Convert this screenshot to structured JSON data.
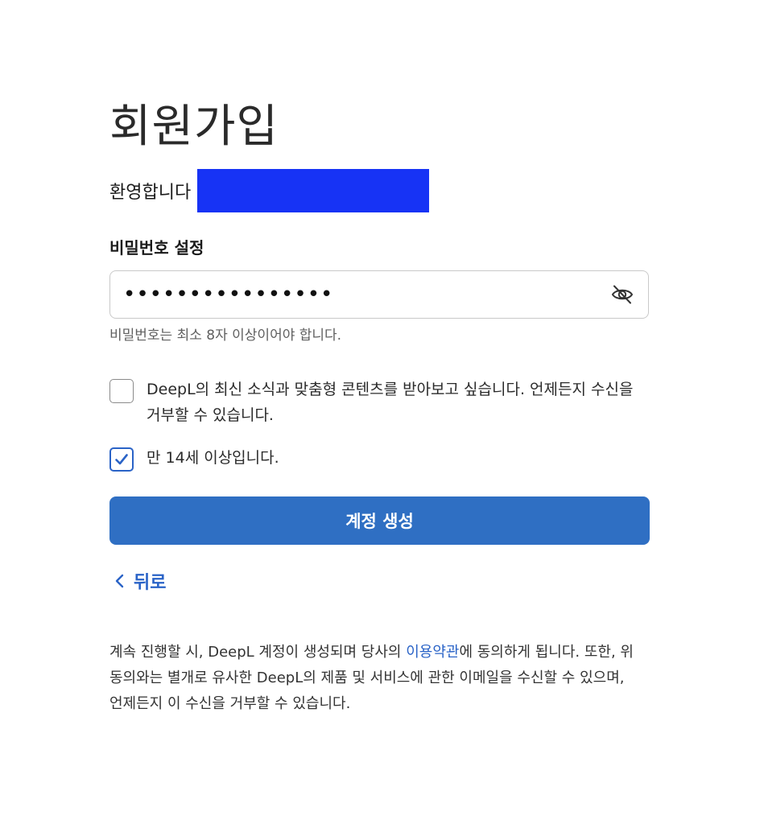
{
  "signup": {
    "title": "회원가입",
    "welcome": "환영합니다",
    "password_label": "비밀번호 설정",
    "password_value": "••••••••••••••••",
    "password_hint": "비밀번호는 최소 8자 이상이어야 합니다.",
    "newsletter": {
      "label": "DeepL의 최신 소식과 맞춤형 콘텐츠를 받아보고 싶습니다. 언제든지 수신을 거부할 수 있습니다.",
      "checked": false
    },
    "age": {
      "label": "만 14세 이상입니다.",
      "checked": true
    },
    "create_button": "계정 생성",
    "back_link": "뒤로",
    "footer": {
      "text_before": "계속 진행할 시, DeepL 계정이 생성되며 당사의 ",
      "terms_link": "이용약관",
      "text_after": "에 동의하게 됩니다. 또한, 위 동의와는 별개로 유사한 DeepL의 제품 및 서비스에 관한 이메일을 수신할 수 있으며, 언제든지 이 수신을 거부할 수 있습니다."
    }
  },
  "icons": {
    "password_toggle": "eye-off-icon",
    "checkmark": "check-icon",
    "back": "chevron-left-icon"
  },
  "colors": {
    "primary": "#2f6fc3",
    "link": "#2a63c7",
    "redaction": "#1733f5"
  }
}
